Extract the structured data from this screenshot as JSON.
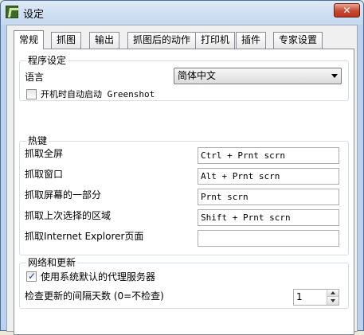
{
  "window": {
    "title": "设定",
    "close_label": "✕"
  },
  "tabs": [
    {
      "label": "常规",
      "active": true
    },
    {
      "label": "抓图",
      "active": false
    },
    {
      "label": "输出",
      "active": false
    },
    {
      "label": "抓图后的动作",
      "active": false
    },
    {
      "label": "打印机",
      "active": false
    },
    {
      "label": "插件",
      "active": false
    },
    {
      "label": "专家设置",
      "active": false
    }
  ],
  "program_settings": {
    "title": "程序设定",
    "language_label": "语言",
    "language_value": "简体中文",
    "autostart_label": "开机时自动启动 Greenshot",
    "autostart_checked": false
  },
  "hotkeys": {
    "title": "热键",
    "rows": [
      {
        "label": "抓取全屏",
        "value": "Ctrl + Prnt scrn"
      },
      {
        "label": "抓取窗口",
        "value": "Alt + Prnt scrn"
      },
      {
        "label": "抓取屏幕的一部分",
        "value": "Prnt scrn"
      },
      {
        "label": "抓取上次选择的区域",
        "value": "Shift + Prnt scrn"
      },
      {
        "label": "抓取Internet Explorer页面",
        "value": ""
      }
    ]
  },
  "network": {
    "title": "网络和更新",
    "proxy_label": "使用系统默认的代理服务器",
    "proxy_checked": true,
    "check_mark": "✓",
    "update_label": "检查更新的间隔天数 (0=不检查)",
    "update_value": "1"
  }
}
